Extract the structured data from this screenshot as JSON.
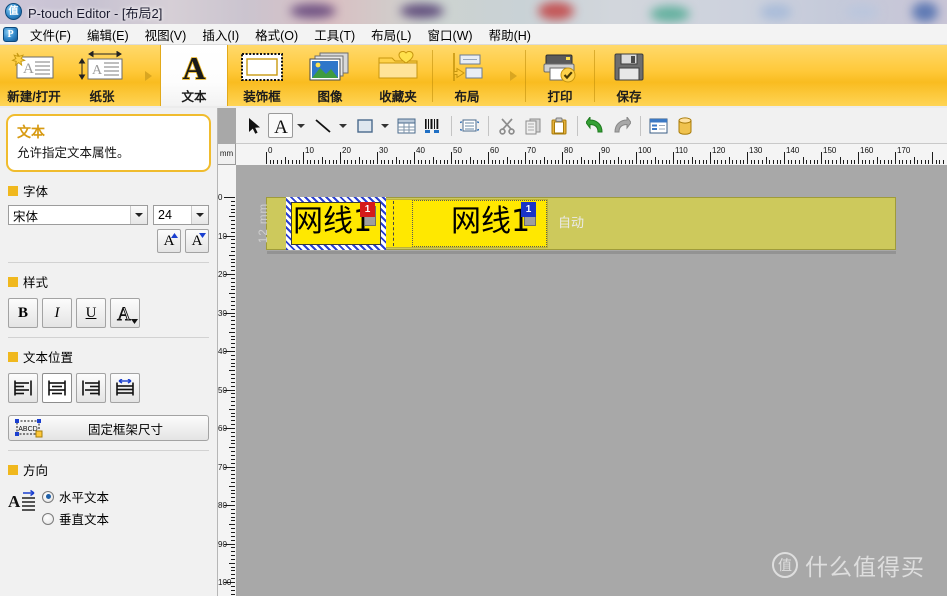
{
  "window": {
    "title": "P-touch Editor - [布局2]",
    "app_icon": "ptouch-logo-icon"
  },
  "menubar": {
    "logo_icon": "ptouch-logo-icon",
    "items": [
      {
        "label": "文件(F)",
        "name": "menu-file"
      },
      {
        "label": "编辑(E)",
        "name": "menu-edit"
      },
      {
        "label": "视图(V)",
        "name": "menu-view"
      },
      {
        "label": "插入(I)",
        "name": "menu-insert"
      },
      {
        "label": "格式(O)",
        "name": "menu-format"
      },
      {
        "label": "工具(T)",
        "name": "menu-tools"
      },
      {
        "label": "布局(L)",
        "name": "menu-layout"
      },
      {
        "label": "窗口(W)",
        "name": "menu-window"
      },
      {
        "label": "帮助(H)",
        "name": "menu-help"
      }
    ]
  },
  "ribbon": {
    "accent_color": "#ffc93a",
    "buttons": [
      {
        "label": "新建/打开",
        "icon": "new-open-icon",
        "selected": false
      },
      {
        "label": "纸张",
        "icon": "paper-icon",
        "selected": false
      },
      {
        "label": "文本",
        "icon": "text-a-icon",
        "selected": true
      },
      {
        "label": "装饰框",
        "icon": "frame-icon",
        "selected": false
      },
      {
        "label": "图像",
        "icon": "image-icon",
        "selected": false
      },
      {
        "label": "收藏夹",
        "icon": "favorites-folder-icon",
        "selected": false
      },
      {
        "label": "布局",
        "icon": "layout-icon",
        "selected": false
      },
      {
        "label": "打印",
        "icon": "print-icon",
        "selected": false
      },
      {
        "label": "保存",
        "icon": "save-floppy-icon",
        "selected": false
      }
    ]
  },
  "toolstrip": {
    "items": [
      {
        "name": "select-arrow-tool",
        "icon": "cursor-arrow-icon"
      },
      {
        "name": "text-tool",
        "icon": "text-a-icon"
      },
      {
        "name": "text-tool-dropdown",
        "icon": "chevron-down-icon"
      },
      {
        "name": "line-tool",
        "icon": "line-icon"
      },
      {
        "name": "line-tool-dropdown",
        "icon": "chevron-down-icon"
      },
      {
        "name": "rectangle-tool",
        "icon": "rectangle-icon"
      },
      {
        "name": "rectangle-tool-dropdown",
        "icon": "chevron-down-icon"
      },
      {
        "name": "table-tool",
        "icon": "table-icon"
      },
      {
        "name": "barcode-tool",
        "icon": "barcode-icon"
      },
      {
        "name": "database-connect-tool",
        "icon": "db-link-icon"
      },
      {
        "name": "cut-button",
        "icon": "scissors-icon"
      },
      {
        "name": "copy-button",
        "icon": "copy-icon"
      },
      {
        "name": "paste-button",
        "icon": "clipboard-icon"
      },
      {
        "name": "undo-button",
        "icon": "undo-arrow-icon"
      },
      {
        "name": "redo-button",
        "icon": "redo-arrow-icon"
      },
      {
        "name": "properties-button",
        "icon": "properties-icon"
      },
      {
        "name": "database-button",
        "icon": "database-cylinder-icon"
      }
    ]
  },
  "panel": {
    "card": {
      "title": "文本",
      "description": "允许指定文本属性。"
    },
    "sections": {
      "font": {
        "title": "字体",
        "font_family": "宋体",
        "font_size": "24",
        "increase_label": "A",
        "decrease_label": "A"
      },
      "style": {
        "title": "样式",
        "bold": "B",
        "italic": "I",
        "underline": "U",
        "outline": "A"
      },
      "text_position": {
        "title": "文本位置",
        "align_left": "align-left-icon",
        "align_center": "align-center-icon",
        "align_right": "align-right-icon",
        "align_justify": "align-justify-icon",
        "fixed_frame_label": "固定框架尺寸",
        "fixed_frame_icon": "fixed-frame-abcd-icon",
        "selected_align": "center"
      },
      "direction": {
        "title": "方向",
        "icon": "text-direction-icon",
        "options": [
          {
            "label": "水平文本",
            "selected": true
          },
          {
            "label": "垂直文本",
            "selected": false
          }
        ]
      }
    }
  },
  "rulers": {
    "unit": "mm",
    "horizontal_labels": [
      "0",
      "10",
      "20",
      "30",
      "40",
      "50",
      "60",
      "70",
      "80",
      "90",
      "100",
      "110",
      "120",
      "130",
      "140",
      "150",
      "160",
      "170"
    ],
    "vertical_labels": [
      "0",
      "10",
      "20",
      "30",
      "40",
      "50",
      "60",
      "70",
      "80",
      "90",
      "100"
    ]
  },
  "canvas": {
    "background_color": "#a8a8a8",
    "tape_color": "#cdc95c",
    "tape_height_label": "12 mm",
    "auto_length_label": "自动",
    "objects": [
      {
        "name": "text-object-1",
        "text": "网线1",
        "badge": "1",
        "badge_color": "#d51a1a",
        "selected": true
      },
      {
        "name": "text-object-2",
        "text": "网线1",
        "badge": "1",
        "badge_color": "#1a34c8",
        "selected": false
      }
    ]
  },
  "watermark": {
    "mark": "值",
    "text": "什么值得买"
  }
}
